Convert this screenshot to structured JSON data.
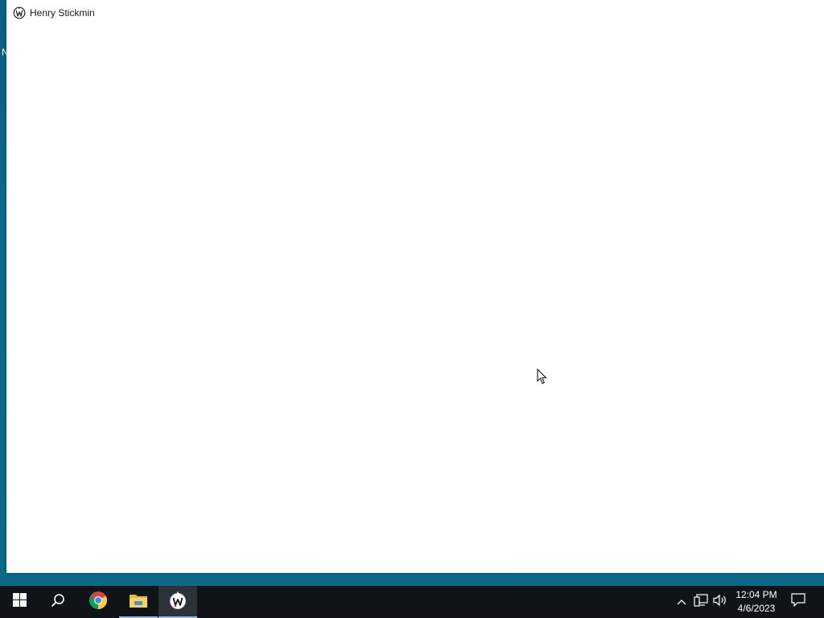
{
  "desktop": {
    "edge_text": "N"
  },
  "window": {
    "title": "Henry Stickmin",
    "app_icon": "henry-stickmin-app-icon"
  },
  "taskbar": {
    "start_icon": "windows-logo-icon",
    "search_icon": "search-icon",
    "pinned": [
      {
        "name": "Google Chrome",
        "icon": "chrome-icon"
      },
      {
        "name": "File Explorer",
        "icon": "folder-icon"
      },
      {
        "name": "Henry Stickmin",
        "icon": "henry-stickmin-app-icon",
        "active": true
      }
    ],
    "tray_icons": [
      "chevron-up-icon",
      "network-icon",
      "volume-icon"
    ],
    "clock": {
      "time": "12:04 PM",
      "date": "4/6/2023"
    },
    "notification_icon": "action-center-icon"
  },
  "colors": {
    "desktop_bg": "#0b6589",
    "taskbar_bg": "#101418",
    "taskbar_active": "#2c3238",
    "active_indicator": "#8fb8e8"
  }
}
